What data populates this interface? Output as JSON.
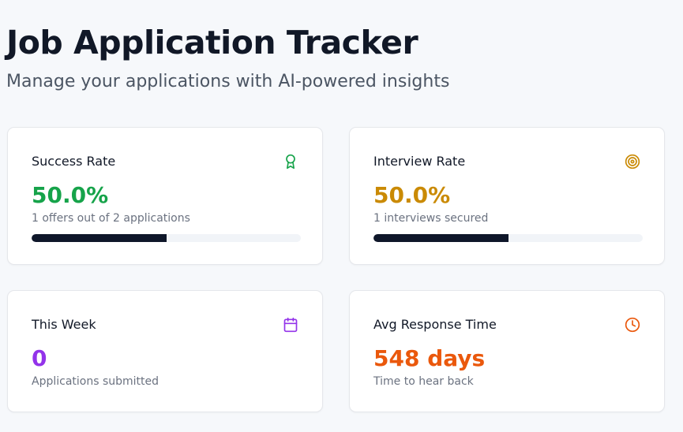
{
  "header": {
    "title": "Job Application Tracker",
    "subtitle": "Manage your applications with AI-powered insights"
  },
  "cards": [
    {
      "label": "Success Rate",
      "value": "50.0%",
      "sub": "1 offers out of 2 applications",
      "icon": "award-icon",
      "color": "#16a34a",
      "progress": 0.5
    },
    {
      "label": "Interview Rate",
      "value": "50.0%",
      "sub": "1 interviews secured",
      "icon": "target-icon",
      "color": "#ca8a04",
      "progress": 0.5
    },
    {
      "label": "This Week",
      "value": "0",
      "sub": "Applications submitted",
      "icon": "calendar-icon",
      "color": "#9333ea"
    },
    {
      "label": "Avg Response Time",
      "value": "548 days",
      "sub": "Time to hear back",
      "icon": "clock-icon",
      "color": "#ea580c"
    }
  ],
  "colors": {
    "progress_fill": "#0f172a",
    "progress_track": "#f1f4f8"
  }
}
